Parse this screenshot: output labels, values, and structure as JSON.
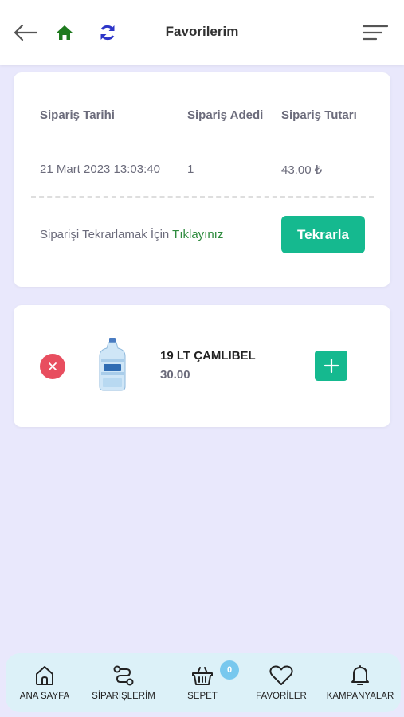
{
  "header": {
    "title": "Favorilerim",
    "icons": {
      "back": "arrow-left-icon",
      "home": "home-icon",
      "refresh": "refresh-icon",
      "menu": "menu-icon"
    },
    "colors": {
      "home": "#1e7a1e",
      "refresh": "#2d35c8"
    }
  },
  "order": {
    "columns": [
      "Sipariş Tarihi",
      "Sipariş Adedi",
      "Sipariş Tutarı"
    ],
    "values": [
      "21 Mart 2023 13:03:40",
      "1",
      "43.00 ₺"
    ],
    "repeat_text": "Siparişi Tekrarlamak İçin ",
    "repeat_link": "Tıklayınız",
    "repeat_button": "Tekrarla"
  },
  "product": {
    "name": "19 LT ÇAMLIBEL",
    "price": "30.00",
    "image_icon": "water-bottle-icon"
  },
  "bottom_nav": {
    "items": [
      {
        "label": "ANA SAYFA",
        "icon": "home-outline-icon"
      },
      {
        "label": "SİPARİŞLERİM",
        "icon": "route-icon"
      },
      {
        "label": "SEPET",
        "icon": "basket-icon",
        "badge": "0"
      },
      {
        "label": "FAVORİLER",
        "icon": "heart-icon"
      },
      {
        "label": "KAMPANYALAR",
        "icon": "bell-icon"
      }
    ]
  },
  "colors": {
    "accent": "#15b98f",
    "danger": "#e84e5f",
    "background": "#e9e8fc",
    "nav_background": "#dcf1f8",
    "link": "#2e8b3e"
  }
}
